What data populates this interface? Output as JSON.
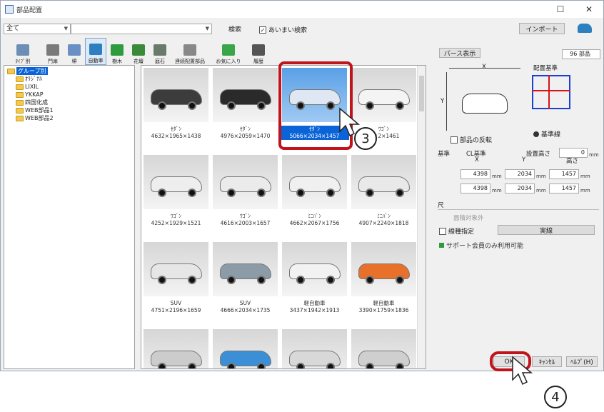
{
  "window": {
    "title": "部品配置"
  },
  "toolbar": {
    "filter_value": "全て",
    "search_value": "",
    "search_button": "検索",
    "fuzzy_search_label": "あいまい検索",
    "fuzzy_search_checked": true,
    "import_button": "インポート"
  },
  "categories": [
    {
      "label": "ﾀｲﾌﾟ別",
      "icon": "type-icon",
      "color": "#6d8fb5"
    },
    {
      "label": "門扉",
      "icon": "gate-icon",
      "color": "#7a7a7a"
    },
    {
      "label": "塀",
      "icon": "fence-icon",
      "color": "#6a8fc4"
    },
    {
      "label": "自動車",
      "icon": "car-icon",
      "color": "#2e7fbf",
      "selected": true
    },
    {
      "label": "樹木",
      "icon": "tree-icon",
      "color": "#2e9b3e"
    },
    {
      "label": "花壇",
      "icon": "flowerbed-icon",
      "color": "#3a8a3a"
    },
    {
      "label": "庭石",
      "icon": "stone-icon",
      "color": "#6a7a6a"
    },
    {
      "label": "連続配置部品",
      "icon": "continuous-icon",
      "color": "#888888"
    },
    {
      "label": "お気に入り",
      "icon": "star-icon",
      "color": "#3aa64a"
    },
    {
      "label": "履歴",
      "icon": "history-icon",
      "color": "#555555"
    }
  ],
  "tree": [
    {
      "label": "グループ別",
      "level": 0,
      "selected": true
    },
    {
      "label": "ｵﾘｼﾞﾅﾙ",
      "level": 1
    },
    {
      "label": "LIXIL",
      "level": 1
    },
    {
      "label": "YKKAP",
      "level": 1
    },
    {
      "label": "四国化成",
      "level": 1
    },
    {
      "label": "WEB部品1",
      "level": 1
    },
    {
      "label": "WEB部品2",
      "level": 1
    }
  ],
  "parts": [
    {
      "name": "ｾﾀﾞﾝ",
      "dims": "4632×1965×1438",
      "color": "#3c3c3c"
    },
    {
      "name": "ｾﾀﾞﾝ",
      "dims": "4976×2059×1470",
      "color": "#2a2a2a"
    },
    {
      "name": "ｾﾀﾞﾝ",
      "dims": "5066×2034×1457",
      "color": "#dfe8f2",
      "selected": true
    },
    {
      "name": "ﾜｺﾞﾝ",
      "dims": "…×2×1461",
      "color": "#f4f4f4"
    },
    {
      "name": "ﾜｺﾞﾝ",
      "dims": "4252×1929×1521",
      "color": "#eeeeee"
    },
    {
      "name": "ﾜｺﾞﾝ",
      "dims": "4616×2003×1657",
      "color": "#ebebeb"
    },
    {
      "name": "ﾐﾆﾊﾞﾝ",
      "dims": "4662×2067×1756",
      "color": "#f0f0f0"
    },
    {
      "name": "ﾐﾆﾊﾞﾝ",
      "dims": "4907×2240×1818",
      "color": "#e9e9e9"
    },
    {
      "name": "SUV",
      "dims": "4751×2196×1659",
      "color": "#e6e6e6"
    },
    {
      "name": "SUV",
      "dims": "4666×2034×1735",
      "color": "#8c9ba8"
    },
    {
      "name": "軽自動車",
      "dims": "3437×1942×1913",
      "color": "#f2f2f2"
    },
    {
      "name": "軽自動車",
      "dims": "3390×1759×1836",
      "color": "#e8702a"
    },
    {
      "name": "",
      "dims": "",
      "color": "#cccccc"
    },
    {
      "name": "",
      "dims": "",
      "color": "#3a8fd6"
    },
    {
      "name": "",
      "dims": "",
      "color": "#d8d8d8"
    },
    {
      "name": "",
      "dims": "",
      "color": "#cfcfcf"
    }
  ],
  "right": {
    "perspective_button": "パース表示",
    "count": "96 部品",
    "dim_x_label": "X",
    "dim_y_label": "Y",
    "placement_ref_label": "配置基準",
    "flip_label": "部品の反転",
    "std_line_label": "基準線",
    "base_label": "基準",
    "cl_label": "CL基準",
    "height_label": "設置高さ",
    "height_value": "0",
    "col_x": "X",
    "col_y": "Y",
    "col_h": "高さ",
    "row1_x": "4398",
    "row1_y": "2034",
    "row1_h": "1457",
    "row2_x": "4398",
    "row2_y": "2034",
    "row2_h": "1457",
    "unit_mm": "mm",
    "dim_label": "尺",
    "no_count_label": "面積対象外",
    "line_spec_label": "線種指定",
    "line_type": "実線",
    "support_note": "サポート会員のみ利用可能",
    "ok_button": "OK",
    "cancel_button": "ｷｬﾝｾﾙ",
    "help_button": "ﾍﾙﾌﾟ(H)"
  },
  "annotations": {
    "step3": "3",
    "step4": "4"
  }
}
